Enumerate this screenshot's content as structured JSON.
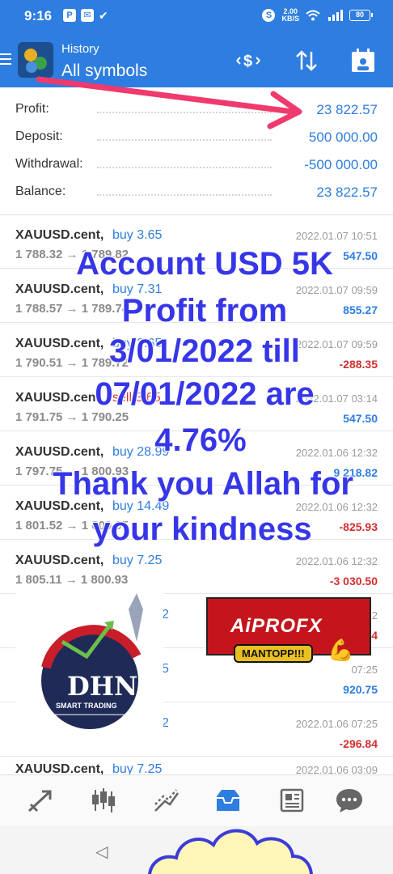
{
  "status_bar": {
    "time": "9:16",
    "speed_value": "2.00",
    "speed_unit": "KB/S",
    "battery": "80"
  },
  "app_bar": {
    "subtitle": "History",
    "title": "All symbols"
  },
  "summary": {
    "rows": [
      {
        "label": "Profit:",
        "value": "23 822.57"
      },
      {
        "label": "Deposit:",
        "value": "500 000.00"
      },
      {
        "label": "Withdrawal:",
        "value": "-500 000.00"
      },
      {
        "label": "Balance:",
        "value": "23 822.57"
      }
    ]
  },
  "trades": [
    {
      "symbol": "XAUUSD.cent,",
      "side": "buy 3.65",
      "prices": "1 788.32 → 1 789.82",
      "datetime": "2022.01.07 10:51",
      "profit": "547.50",
      "side_color": "#2e7de0",
      "profit_color": "#2e7de0"
    },
    {
      "symbol": "XAUUSD.cent,",
      "side": "buy 7.31",
      "prices": "1 788.57 → 1 789.74",
      "datetime": "2022.01.07 09:59",
      "profit": "855.27",
      "side_color": "#2e7de0",
      "profit_color": "#2e7de0"
    },
    {
      "symbol": "XAUUSD.cent,",
      "side": "buy 3.65",
      "prices": "1 790.51 → 1 789.72",
      "datetime": "2022.01.07 09:59",
      "profit": "-288.35",
      "side_color": "#2e7de0",
      "profit_color": "#d32f2f"
    },
    {
      "symbol": "XAUUSD.cent,",
      "side": "sell 3.65",
      "prices": "1 791.75 → 1 790.25",
      "datetime": "2022.01.07 03:14",
      "profit": "547.50",
      "side_color": "#d32f2f",
      "profit_color": "#2e7de0"
    },
    {
      "symbol": "XAUUSD.cent,",
      "side": "buy 28.99",
      "prices": "1 797.75 → 1 800.93",
      "datetime": "2022.01.06 12:32",
      "profit": "9 218.82",
      "side_color": "#2e7de0",
      "profit_color": "#2e7de0"
    },
    {
      "symbol": "XAUUSD.cent,",
      "side": "buy 14.49",
      "prices": "1 801.52 → 1 800.95",
      "datetime": "2022.01.06 12:32",
      "profit": "-825.93",
      "side_color": "#2e7de0",
      "profit_color": "#d32f2f"
    },
    {
      "symbol": "XAUUSD.cent,",
      "side": "buy 7.25",
      "prices": "1 805.11 → 1 800.93",
      "datetime": "2022.01.06 12:32",
      "profit": "-3 030.50",
      "side_color": "#2e7de0",
      "profit_color": "#d32f2f"
    },
    {
      "symbol": "",
      "side": "2",
      "prices": "",
      "datetime": "2",
      "profit": "74",
      "side_color": "#2e7de0",
      "profit_color": "#d32f2f"
    },
    {
      "symbol": "",
      "side": "5",
      "prices": "",
      "datetime": "07:25",
      "profit": "920.75",
      "side_color": "#2e7de0",
      "profit_color": "#2e7de0"
    },
    {
      "symbol": "",
      "side": "2",
      "prices": "",
      "datetime": "2022.01.06 07:25",
      "profit": "-296.84",
      "side_color": "#2e7de0",
      "profit_color": "#d32f2f"
    },
    {
      "symbol": "XAUUSD.cent,",
      "side": "buy 7.25",
      "prices": "",
      "datetime": "2022.01.06 03:09",
      "profit": "",
      "side_color": "#2e7de0",
      "profit_color": "#2e7de0"
    }
  ],
  "overlay": {
    "lines": [
      "Account USD 5K",
      "Profit from",
      "3/01/2022 till",
      "07/01/2022 are",
      "4.76%",
      "Thank you Allah for",
      "your kindness"
    ]
  },
  "dhn_logo": {
    "text": "DHN",
    "sub": "SMART TRADING"
  },
  "aiprofx_logo": {
    "title": "AiPROFX",
    "sub": "MANTOPP!!!"
  },
  "colors": {
    "accent": "#2e7de0",
    "negative": "#d32f2f",
    "overlay_text": "#3636e8",
    "arrow": "#ef3a6e"
  },
  "bottom_nav": {
    "active": "history",
    "items": [
      "quotes",
      "chart",
      "trade",
      "history",
      "news",
      "messages"
    ]
  }
}
